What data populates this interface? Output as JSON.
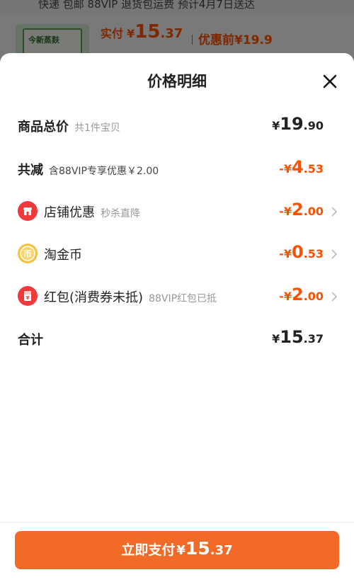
{
  "background": {
    "top_text": "快递 包邮 88VIP 退货包运费 预计4月7日送达",
    "price_label": "实付",
    "price_currency": "¥",
    "price_int": "15",
    "price_dec": ".37",
    "price_before": "优惠前¥19.9",
    "thumb_label": "今新蒸麸"
  },
  "sheet": {
    "title": "价格明细",
    "rows": [
      {
        "label": "商品总价",
        "sub": "共1件宝贝",
        "currency": "¥",
        "int": "19",
        "dec": ".90"
      },
      {
        "label": "共减",
        "sub": "含88VIP专享优惠￥2.00",
        "currency": "-¥",
        "int": "4",
        "dec": ".53"
      },
      {
        "label": "店铺优惠",
        "sub": "秒杀直降",
        "currency": "-¥",
        "int": "2",
        "dec": ".00",
        "icon": "store-icon"
      },
      {
        "label": "淘金币",
        "sub": "",
        "currency": "-¥",
        "int": "0",
        "dec": ".53",
        "icon": "coin-icon"
      },
      {
        "label": "红包(消费券未抵)",
        "sub": "88VIP红包已抵",
        "currency": "-¥",
        "int": "2",
        "dec": ".00",
        "icon": "red-packet-icon"
      },
      {
        "label": "合计",
        "sub": "",
        "currency": "¥",
        "int": "15",
        "dec": ".37"
      }
    ],
    "pay_button": {
      "label": "立即支付",
      "currency": "¥",
      "int": "15",
      "dec": ".37"
    }
  },
  "colors": {
    "accent": "#ff5000",
    "button": "#f26a28",
    "icon_red": "#ee3a3a",
    "icon_gold": "#f6c13f"
  }
}
